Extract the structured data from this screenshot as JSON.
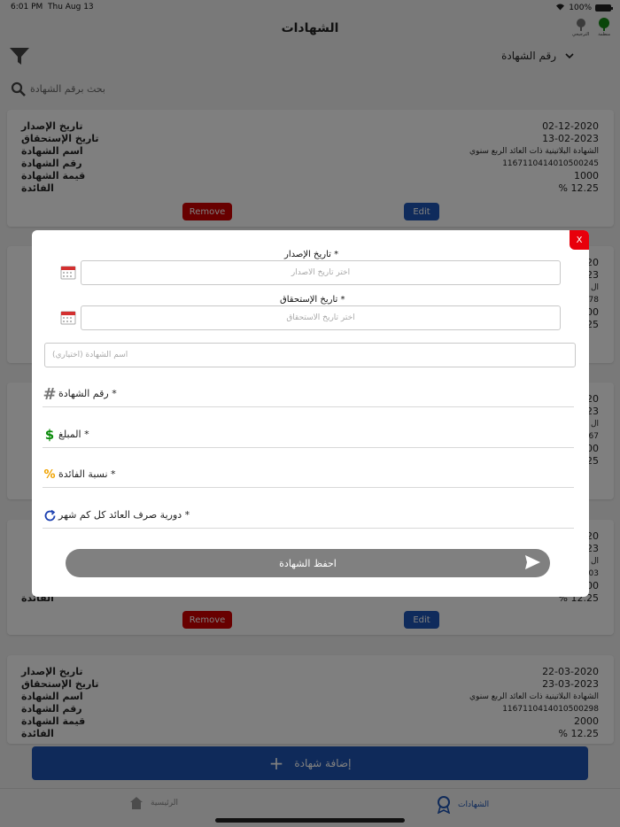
{
  "status_bar": {
    "time": "6:01 PM",
    "date": "Thu Aug 13",
    "battery": "100%"
  },
  "nav": {
    "title": "الشهادات",
    "icons": [
      {
        "label": "الترجيحي",
        "icon": "tree-outline-icon"
      },
      {
        "label": "منظمة",
        "icon": "tree-green-icon"
      }
    ]
  },
  "filter": {
    "sort_value": "رقم الشهادة"
  },
  "search": {
    "placeholder": "بحث برقم الشهادة"
  },
  "field_labels": {
    "issue_date": "تاريخ الإصدار",
    "due_date": "تاريخ الإستحقاق",
    "cert_name": "اسم الشهادة",
    "cert_number": "رقم الشهادة",
    "cert_value": "قيمة الشهادة",
    "interest": "الفائدة"
  },
  "card_buttons": {
    "remove": "Remove",
    "edit": "Edit"
  },
  "cards": [
    {
      "issue_date": "02-12-2020",
      "due_date": "13-02-2023",
      "name": "الشهادة البلاتينية ذات العائد الربع سنوي",
      "number": "1167110414010500245",
      "value": "1000",
      "interest": "% 12.25"
    },
    {
      "issue_date": "20",
      "due_date": "23",
      "name": "ال",
      "number": "78",
      "value": "00",
      "interest": "25"
    },
    {
      "issue_date": "20",
      "due_date": "23",
      "name": "ال",
      "number": "67",
      "value": "00",
      "interest": "25"
    },
    {
      "issue_date": "20",
      "due_date": "23",
      "name": "ال",
      "number": "03",
      "value": "00",
      "interest": "% 12.25"
    },
    {
      "issue_date": "22-03-2020",
      "due_date": "23-03-2023",
      "name": "الشهادة البلاتينية ذات العائد الربع سنوي",
      "number": "1167110414010500298",
      "value": "2000",
      "interest": "% 12.25"
    }
  ],
  "partial_labels": {
    "issue": "دار",
    "due": "اق",
    "interest": "الفائدة"
  },
  "add_button": {
    "label": "إضافة شهادة"
  },
  "tabs": [
    {
      "label": "الرئيسية",
      "icon": "home-icon"
    },
    {
      "label": "الشهادات",
      "icon": "certificate-icon"
    }
  ],
  "modal": {
    "close": "X",
    "issue_label": "تاريخ الإصدار *",
    "issue_placeholder": "اختر تاريخ الاصدار",
    "due_label": "تاريخ الإستحقاق *",
    "due_placeholder": "اختر تاريخ الاستحقاق",
    "name_placeholder": "اسم الشهادة (اختياري)",
    "number_label": "رقم الشهادة *",
    "amount_label": "المبلغ *",
    "rate_label": "نسبة الفائدة *",
    "frequency_label": "دورية صرف العائد كل كم شهر *",
    "save": "احفظ الشهادة"
  },
  "colors": {
    "primary": "#1e55b4",
    "remove": "#d10000",
    "close": "#e8000b",
    "save": "#808080",
    "money_icon": "#0a8a0a",
    "percent_icon": "#f0a300",
    "calendar_icon": "#d33030"
  }
}
